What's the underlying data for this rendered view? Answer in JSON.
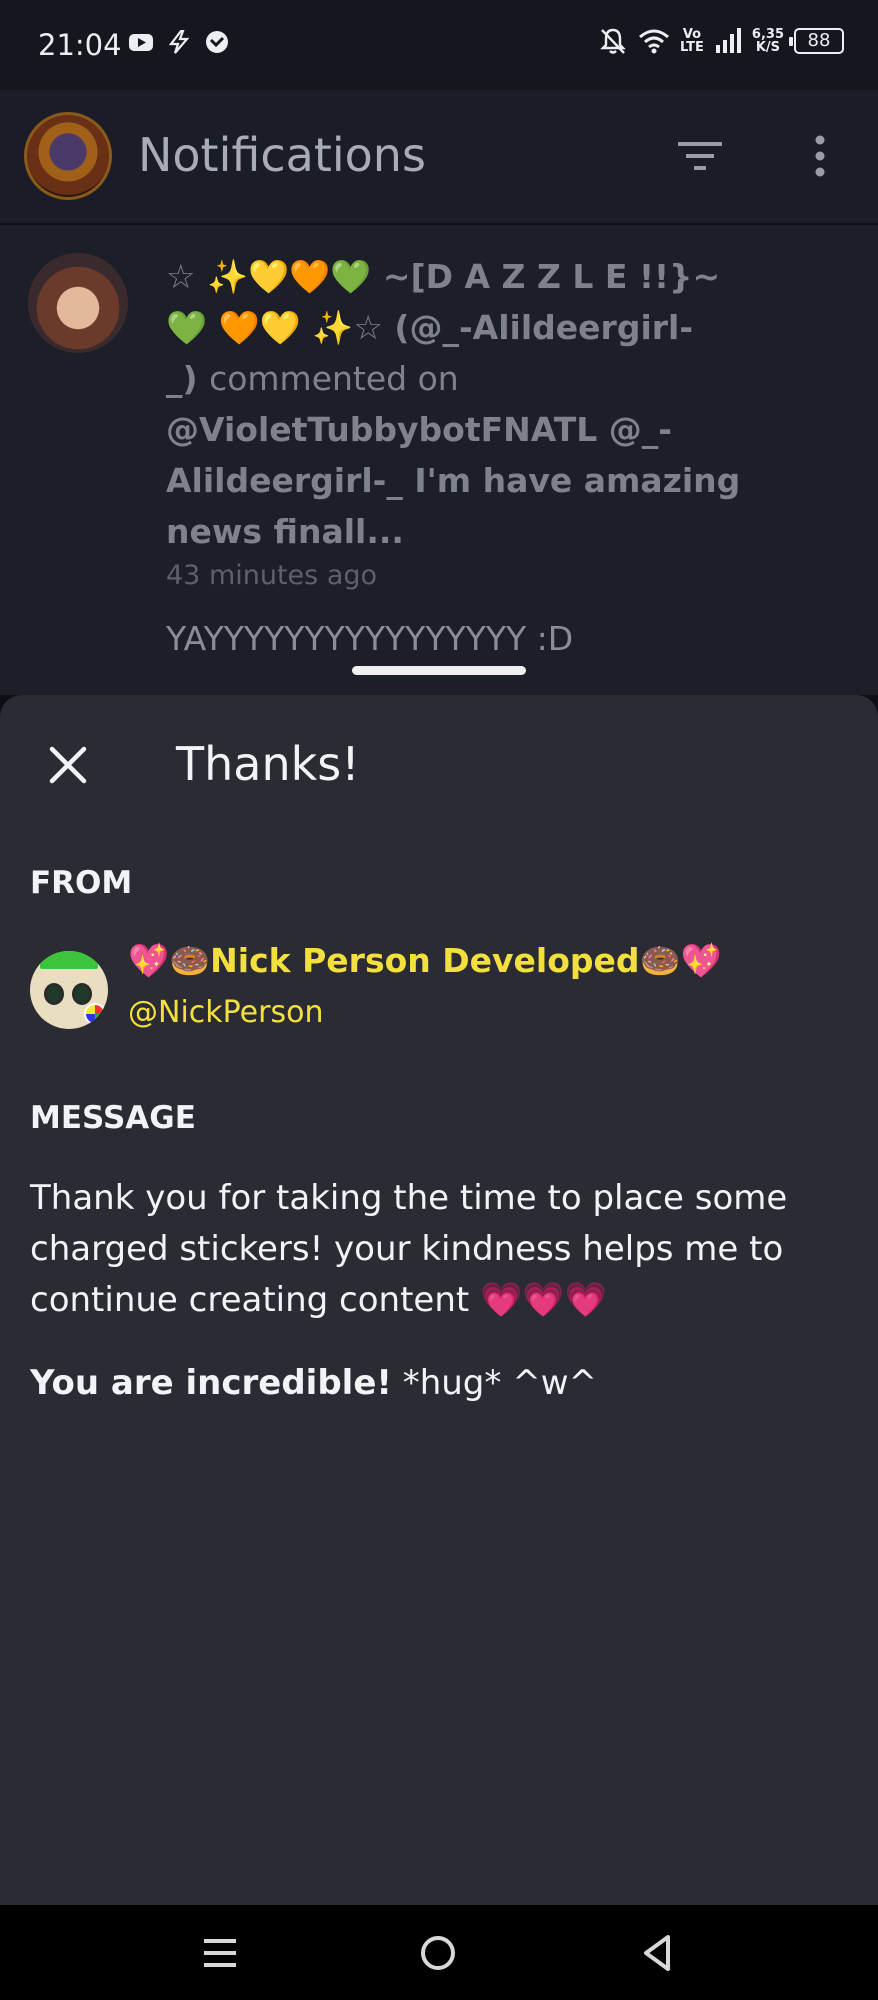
{
  "status_bar": {
    "time": "21:04",
    "network_top": "Vo",
    "network_bottom": "LTE",
    "speed_value": "6,35",
    "speed_unit": "K/S",
    "battery": "88",
    "icons": [
      "youtube-icon",
      "bolt-icon",
      "message-icon",
      "dnd-bell-icon",
      "wifi-icon",
      "signal-icon",
      "battery-icon"
    ]
  },
  "app_bar": {
    "title": "Notifications",
    "icons": [
      "filter-icon",
      "more-vert-icon"
    ]
  },
  "notification": {
    "line1": "☆ ✨💛🧡💚      ~[D A Z Z L E !!}~",
    "line2": "💚      🧡💛 ✨☆ (@_-Alildeergirl-",
    "line3_prefix": "_) ",
    "line3_action": "commented on",
    "line4": "@VioletTubbybotFNATL @_-",
    "line5": "Alildeergirl-_ I'm have amazing",
    "line6": "news finall...",
    "time": "43 minutes ago",
    "reply": "YAYYYYYYYYYYYYYYYY :D"
  },
  "sheet": {
    "title": "Thanks!",
    "from_label": "FROM",
    "sender_name": "💖🍩Nick Person Developed🍩💖",
    "sender_handle": "@NickPerson",
    "message_label": "MESSAGE",
    "message_body": "Thank you for taking the time to place some charged stickers! your kindness helps me to continue creating content 💗💗💗",
    "closing_bold": "You are incredible!",
    "closing_rest": " *hug* ^w^"
  },
  "nav_bar": {
    "icons": [
      "menu-icon",
      "home-icon",
      "back-icon"
    ]
  },
  "colors": {
    "accent_yellow": "#f4e03c",
    "sheet_bg": "#2a2b33",
    "app_bar_bg": "#1a1d27"
  }
}
